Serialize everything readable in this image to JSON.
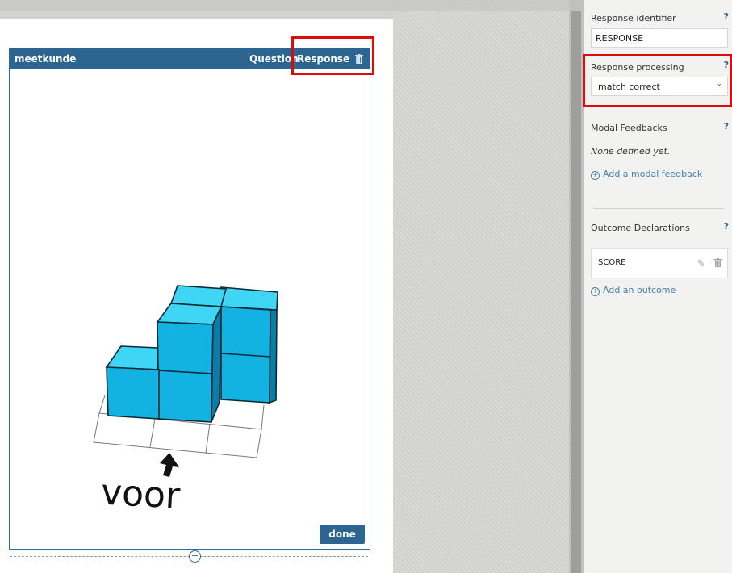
{
  "canvas": {
    "widget": {
      "title": "meetkunde",
      "tabs": {
        "question": "Question",
        "response": "Response"
      },
      "image_text": "voor",
      "done_label": "done"
    },
    "add_block_symbol": "+"
  },
  "panel": {
    "response_identifier": {
      "label": "Response identifier",
      "value": "RESPONSE"
    },
    "response_processing": {
      "label": "Response processing",
      "selected": "match correct"
    },
    "modal_feedbacks": {
      "label": "Modal Feedbacks",
      "empty": "None defined yet.",
      "add_link": "Add a modal feedback"
    },
    "outcome_declarations": {
      "label": "Outcome Declarations",
      "items": [
        "SCORE"
      ],
      "add_link": "Add an outcome"
    },
    "help_symbol": "?"
  },
  "colors": {
    "header": "#2c6690",
    "highlight": "#e10a0a",
    "cube_top": "#3fd6f5",
    "cube_front": "#12b3e3",
    "cube_side": "#0b7ea8"
  },
  "icons": {
    "delete": "trash-icon",
    "edit": "pencil-icon",
    "add": "plus-circle-icon",
    "dropdown": "chevron-down-icon",
    "help": "question-icon"
  }
}
